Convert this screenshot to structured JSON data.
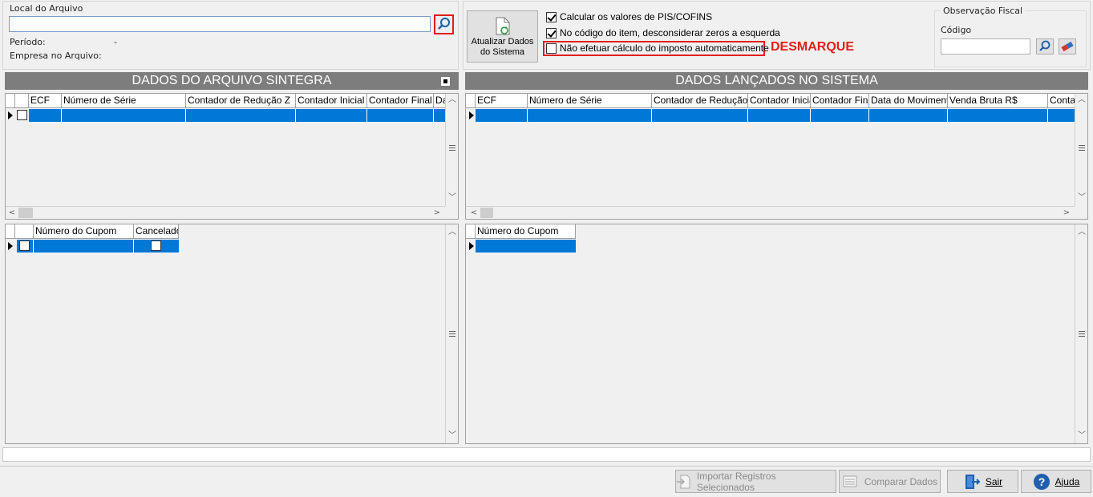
{
  "file": {
    "local_label": "Local do Arquivo",
    "local_value": "",
    "periodo_label": "Período:",
    "periodo_value": "-",
    "empresa_label": "Empresa no Arquivo:"
  },
  "update_button": {
    "label_line1": "Atualizar Dados",
    "label_line2": "do Sistema"
  },
  "options": {
    "calc_pis": {
      "label": "Calcular os valores de PIS/COFINS",
      "checked": true
    },
    "ignore_zeros": {
      "label": "No código do item, desconsiderar zeros a esquerda",
      "checked": true
    },
    "no_auto_calc": {
      "label": "Não efetuar cálculo do imposto automaticamente",
      "checked": false
    }
  },
  "annotation": {
    "text": "DESMARQUE",
    "color": "#e0201a"
  },
  "obs_fiscal": {
    "group_label": "Observação Fiscal",
    "codigo_label": "Código",
    "codigo_value": ""
  },
  "left_header": "DADOS DO ARQUIVO SINTEGRA",
  "right_header": "DADOS LANÇADOS NO SISTEMA",
  "left_grid": {
    "columns": [
      "ECF",
      "Número de Série",
      "Contador de Redução Z",
      "Contador Inicial",
      "Contador Final",
      "Da"
    ]
  },
  "left_coupon_grid": {
    "columns": [
      "Número do Cupom",
      "Cancelado"
    ]
  },
  "right_grid": {
    "columns": [
      "ECF",
      "Número de Série",
      "Contador de Redução Z",
      "Contador Inicial",
      "Contador Final",
      "Data do Movimento",
      "Venda Bruta R$",
      "Conta"
    ]
  },
  "right_coupon_grid": {
    "columns": [
      "Número do Cupom"
    ]
  },
  "footer": {
    "import_label": "Importar Registros Selecionados",
    "compare_label": "Comparar Dados",
    "exit_label": "Sair",
    "help_label": "Ajuda"
  },
  "colors": {
    "selection": "#0078d7",
    "header": "#7d7d7d",
    "highlight_box": "#e0201a"
  }
}
